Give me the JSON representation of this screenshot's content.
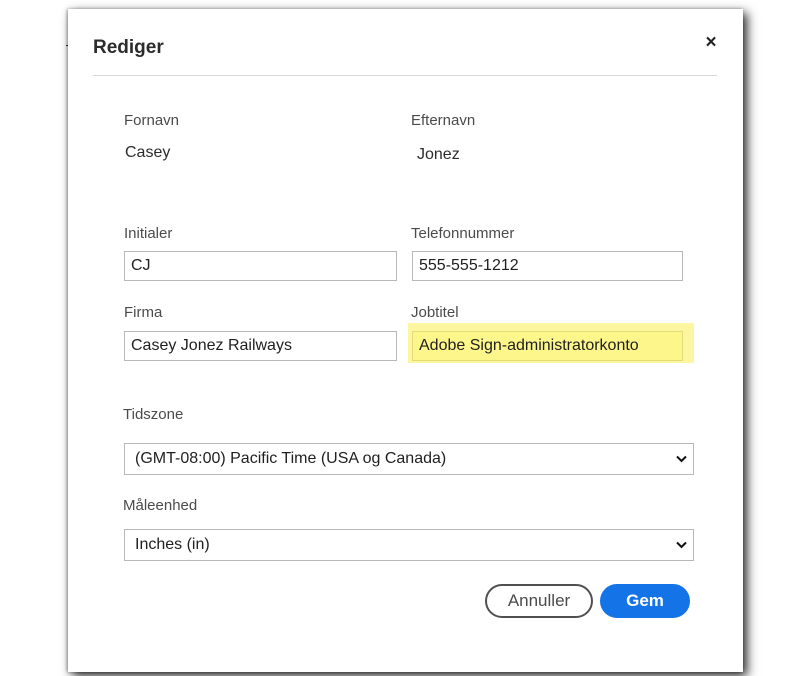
{
  "dialog": {
    "title": "Rediger",
    "close_label": "×"
  },
  "fields": {
    "first_name": {
      "label": "Fornavn",
      "value": "Casey"
    },
    "last_name": {
      "label": "Efternavn",
      "value": "Jonez"
    },
    "initials": {
      "label": "Initialer",
      "value": "CJ"
    },
    "phone": {
      "label": "Telefonnummer",
      "value": "555-555-1212"
    },
    "company": {
      "label": "Firma",
      "value": "Casey Jonez Railways"
    },
    "job_title": {
      "label": "Jobtitel",
      "value": "Adobe Sign-administratorkonto"
    },
    "timezone": {
      "label": "Tidszone",
      "selected": "(GMT-08:00) Pacific Time (USA og Canada)"
    },
    "units": {
      "label": "Måleenhed",
      "selected": "Inches (in)"
    }
  },
  "buttons": {
    "cancel_label": "Annuller",
    "save_label": "Gem"
  },
  "colors": {
    "primary": "#1473e6",
    "highlight": "#fdf68b",
    "border": "#b8b8b8"
  },
  "icons": {
    "close": "close-icon",
    "dropdown": "chevron-down-icon"
  }
}
